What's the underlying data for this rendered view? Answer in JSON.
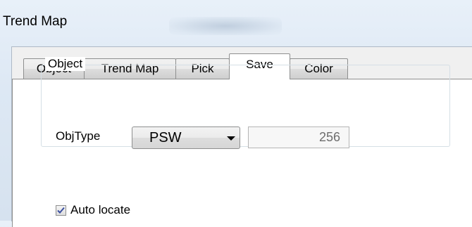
{
  "window": {
    "title": "Trend Map"
  },
  "tabs": [
    {
      "label": "Object",
      "active": false
    },
    {
      "label": "Trend Map",
      "active": false
    },
    {
      "label": "Pick",
      "active": false
    },
    {
      "label": "Save",
      "active": true
    },
    {
      "label": "Color",
      "active": false
    }
  ],
  "object_group": {
    "legend": "Object",
    "objtype_label": "ObjType",
    "objtype_selected": "PSW",
    "address_value": "256"
  },
  "auto_locate": {
    "label": "Auto locate",
    "checked": true
  },
  "colors": {
    "check_mark": "#3b4fa0",
    "panel_background": "#ffffff",
    "dialog_background": "#f0f0f0"
  },
  "icons": {
    "dropdown": "chevron-down-icon",
    "check": "checkmark-icon"
  }
}
